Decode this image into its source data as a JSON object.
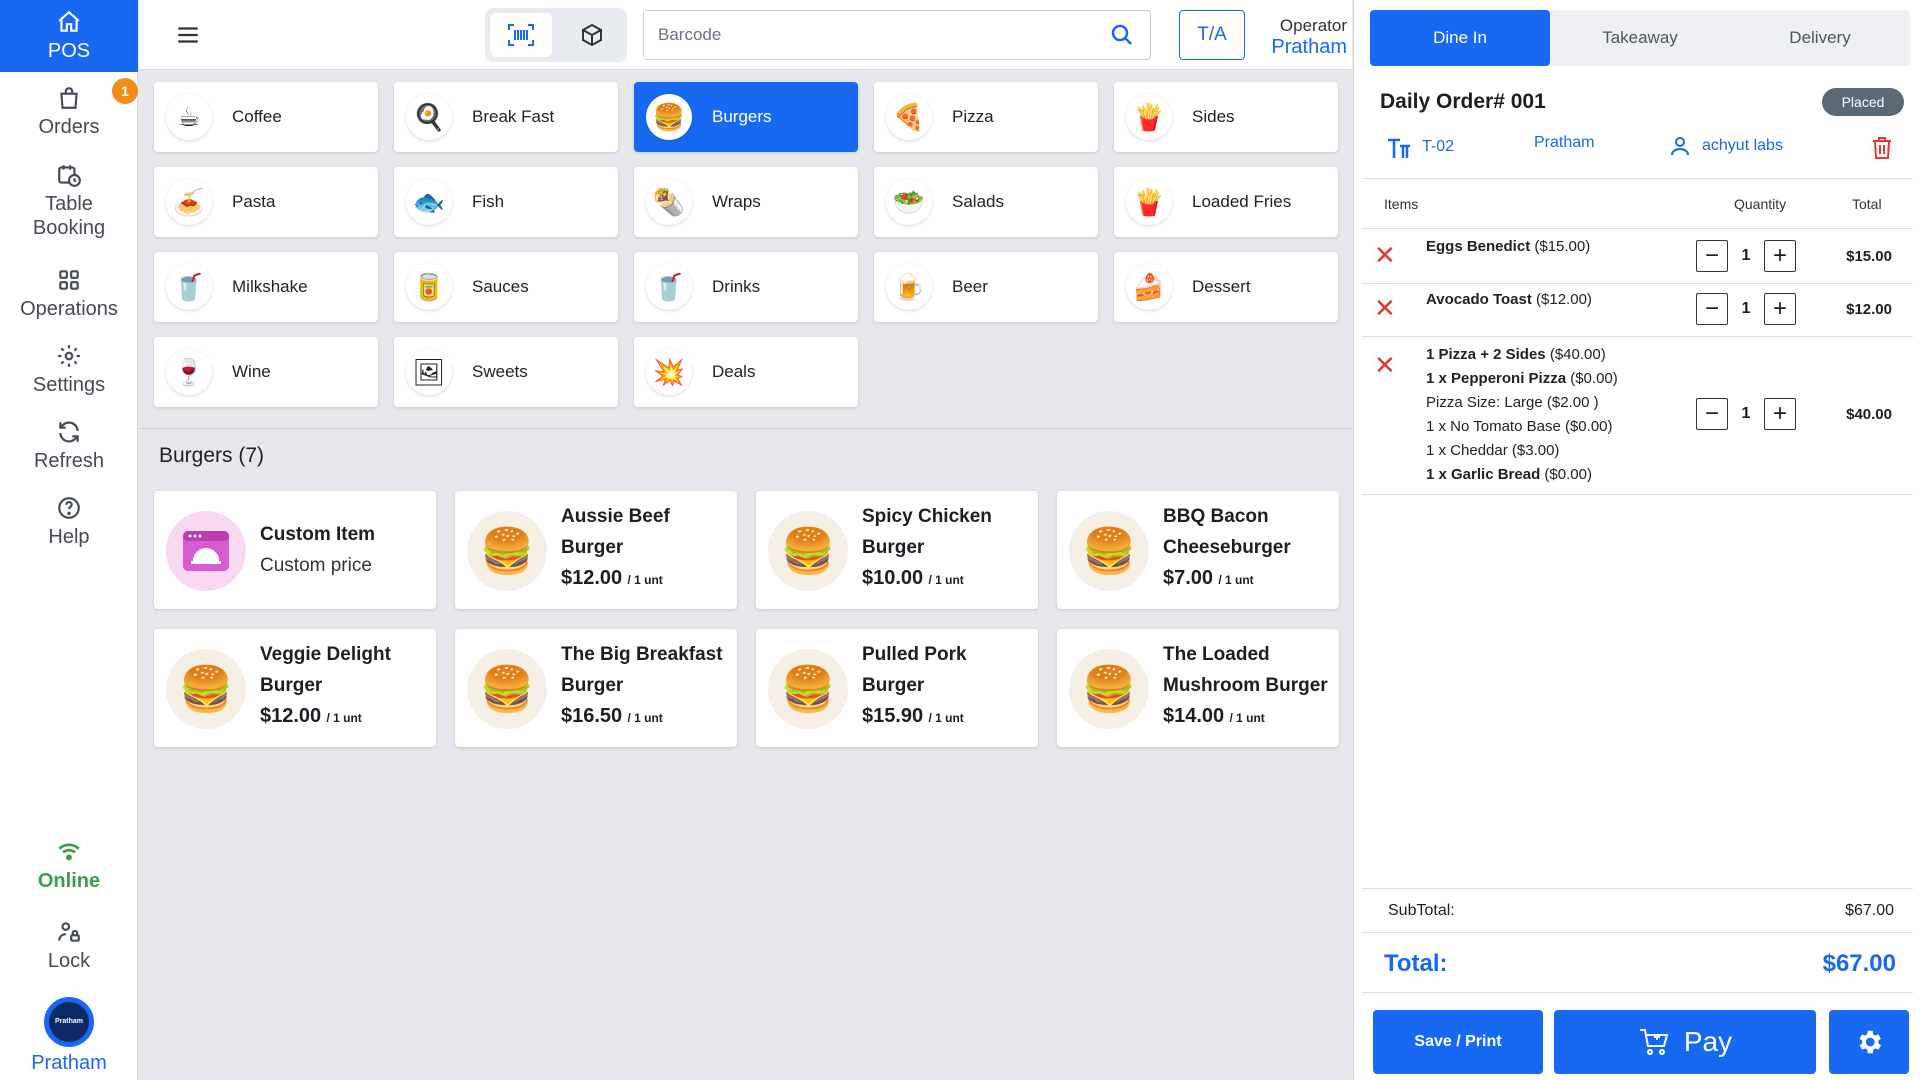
{
  "sidebar": {
    "pos": "POS",
    "orders": "Orders",
    "orders_badge": "1",
    "table_booking": "Table Booking",
    "operations": "Operations",
    "settings": "Settings",
    "refresh": "Refresh",
    "help": "Help",
    "status": "Online",
    "lock": "Lock",
    "user": "Pratham",
    "avatar_text": "Pratham"
  },
  "topbar": {
    "search_placeholder": "Barcode",
    "ta_label": "T/A",
    "operator_label": "Operator",
    "operator_name": "Pratham"
  },
  "categories": [
    {
      "label": "Coffee",
      "icon": "☕"
    },
    {
      "label": "Break Fast",
      "icon": "🍳"
    },
    {
      "label": "Burgers",
      "icon": "🍔"
    },
    {
      "label": "Pizza",
      "icon": "🍕"
    },
    {
      "label": "Sides",
      "icon": "🍟"
    },
    {
      "label": "Pasta",
      "icon": "🍝"
    },
    {
      "label": "Fish",
      "icon": "🐟"
    },
    {
      "label": "Wraps",
      "icon": "🌯"
    },
    {
      "label": "Salads",
      "icon": "🥗"
    },
    {
      "label": "Loaded Fries",
      "icon": "🍟"
    },
    {
      "label": "Milkshake",
      "icon": "🥤"
    },
    {
      "label": "Sauces",
      "icon": "🥫"
    },
    {
      "label": "Drinks",
      "icon": "🥤"
    },
    {
      "label": "Beer",
      "icon": "🍺"
    },
    {
      "label": "Dessert",
      "icon": "🍰"
    },
    {
      "label": "Wine",
      "icon": "🍷"
    },
    {
      "label": "Sweets",
      "icon": "🖼"
    },
    {
      "label": "Deals",
      "icon": "💥"
    }
  ],
  "section": {
    "title": "Burgers (7)"
  },
  "products": [
    {
      "name1": "Custom Item",
      "sub": "Custom price"
    },
    {
      "name1": "Aussie Beef",
      "name2": "Burger",
      "price": "$12.00",
      "unit": "/ 1 unt"
    },
    {
      "name1": "Spicy Chicken",
      "name2": "Burger",
      "price": "$10.00",
      "unit": "/ 1 unt"
    },
    {
      "name1": "BBQ Bacon",
      "name2": "Cheeseburger",
      "price": "$7.00",
      "unit": "/ 1 unt"
    },
    {
      "name1": "Veggie Delight",
      "name2": "Burger",
      "price": "$12.00",
      "unit": "/ 1 unt"
    },
    {
      "name1": "The Big Breakfast",
      "name2": "Burger",
      "price": "$16.50",
      "unit": "/ 1 unt"
    },
    {
      "name1": "Pulled Pork",
      "name2": "Burger",
      "price": "$15.90",
      "unit": "/ 1 unt"
    },
    {
      "name1": "The Loaded",
      "name2": "Mushroom Burger",
      "price": "$14.00",
      "unit": "/ 1 unt"
    }
  ],
  "order": {
    "tabs": [
      "Dine In",
      "Takeaway",
      "Delivery"
    ],
    "title": "Daily Order# 001",
    "status": "Placed",
    "table": "T-02",
    "waiter": "Pratham",
    "customer": "achyut labs",
    "col_items": "Items",
    "col_quantity": "Quantity",
    "col_total": "Total",
    "lines": [
      {
        "name": "Eggs Benedict",
        "price": "($15.00)",
        "qty": "1",
        "total": "$15.00"
      },
      {
        "name": "Avocado Toast",
        "price": "($12.00)",
        "qty": "1",
        "total": "$12.00"
      },
      {
        "name": "1 Pizza + 2 Sides",
        "price": "($40.00)",
        "qty": "1",
        "total": "$40.00",
        "mods": [
          {
            "name": "1 x Pepperoni Pizza",
            "price": "($0.00)"
          },
          {
            "name": "Pizza Size: Large",
            "price": "($2.00 )"
          },
          {
            "name": "1 x No Tomato Base",
            "price": "($0.00)"
          },
          {
            "name": "1 x Cheddar",
            "price": "($3.00)"
          },
          {
            "name": "1 x Garlic Bread",
            "price": "($0.00)"
          }
        ]
      }
    ],
    "subtotal_label": "SubTotal:",
    "subtotal": "$67.00",
    "total_label": "Total:",
    "total": "$67.00",
    "save_print": "Save / Print",
    "pay": "Pay"
  },
  "colors": {
    "accent": "#1669f0",
    "online": "#37a14a",
    "remove": "#e53935",
    "badge": "#f28c1b"
  }
}
